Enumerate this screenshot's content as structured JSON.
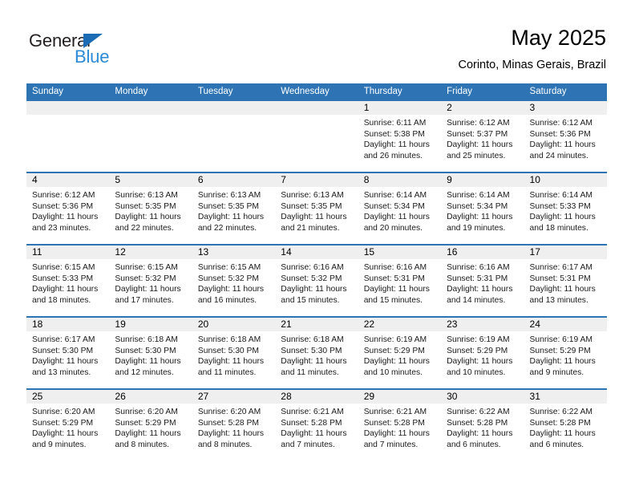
{
  "logo": {
    "word1": "General",
    "word2": "Blue",
    "triangle_color": "#1c6cb5",
    "word2_color": "#2c8ad6"
  },
  "header": {
    "title": "May 2025",
    "subtitle": "Corinto, Minas Gerais, Brazil"
  },
  "theme": {
    "header_bg": "#2e74b5",
    "header_text": "#ffffff",
    "daynum_band_bg": "#efefef",
    "cell_bg": "#ffffff",
    "week_divider": "#2e74b5"
  },
  "calendar": {
    "weekday_headers": [
      "Sunday",
      "Monday",
      "Tuesday",
      "Wednesday",
      "Thursday",
      "Friday",
      "Saturday"
    ],
    "weeks": [
      [
        {
          "day": "",
          "sunrise": "",
          "sunset": "",
          "daylight1": "",
          "daylight2": ""
        },
        {
          "day": "",
          "sunrise": "",
          "sunset": "",
          "daylight1": "",
          "daylight2": ""
        },
        {
          "day": "",
          "sunrise": "",
          "sunset": "",
          "daylight1": "",
          "daylight2": ""
        },
        {
          "day": "",
          "sunrise": "",
          "sunset": "",
          "daylight1": "",
          "daylight2": ""
        },
        {
          "day": "1",
          "sunrise": "Sunrise: 6:11 AM",
          "sunset": "Sunset: 5:38 PM",
          "daylight1": "Daylight: 11 hours",
          "daylight2": "and 26 minutes."
        },
        {
          "day": "2",
          "sunrise": "Sunrise: 6:12 AM",
          "sunset": "Sunset: 5:37 PM",
          "daylight1": "Daylight: 11 hours",
          "daylight2": "and 25 minutes."
        },
        {
          "day": "3",
          "sunrise": "Sunrise: 6:12 AM",
          "sunset": "Sunset: 5:36 PM",
          "daylight1": "Daylight: 11 hours",
          "daylight2": "and 24 minutes."
        }
      ],
      [
        {
          "day": "4",
          "sunrise": "Sunrise: 6:12 AM",
          "sunset": "Sunset: 5:36 PM",
          "daylight1": "Daylight: 11 hours",
          "daylight2": "and 23 minutes."
        },
        {
          "day": "5",
          "sunrise": "Sunrise: 6:13 AM",
          "sunset": "Sunset: 5:35 PM",
          "daylight1": "Daylight: 11 hours",
          "daylight2": "and 22 minutes."
        },
        {
          "day": "6",
          "sunrise": "Sunrise: 6:13 AM",
          "sunset": "Sunset: 5:35 PM",
          "daylight1": "Daylight: 11 hours",
          "daylight2": "and 22 minutes."
        },
        {
          "day": "7",
          "sunrise": "Sunrise: 6:13 AM",
          "sunset": "Sunset: 5:35 PM",
          "daylight1": "Daylight: 11 hours",
          "daylight2": "and 21 minutes."
        },
        {
          "day": "8",
          "sunrise": "Sunrise: 6:14 AM",
          "sunset": "Sunset: 5:34 PM",
          "daylight1": "Daylight: 11 hours",
          "daylight2": "and 20 minutes."
        },
        {
          "day": "9",
          "sunrise": "Sunrise: 6:14 AM",
          "sunset": "Sunset: 5:34 PM",
          "daylight1": "Daylight: 11 hours",
          "daylight2": "and 19 minutes."
        },
        {
          "day": "10",
          "sunrise": "Sunrise: 6:14 AM",
          "sunset": "Sunset: 5:33 PM",
          "daylight1": "Daylight: 11 hours",
          "daylight2": "and 18 minutes."
        }
      ],
      [
        {
          "day": "11",
          "sunrise": "Sunrise: 6:15 AM",
          "sunset": "Sunset: 5:33 PM",
          "daylight1": "Daylight: 11 hours",
          "daylight2": "and 18 minutes."
        },
        {
          "day": "12",
          "sunrise": "Sunrise: 6:15 AM",
          "sunset": "Sunset: 5:32 PM",
          "daylight1": "Daylight: 11 hours",
          "daylight2": "and 17 minutes."
        },
        {
          "day": "13",
          "sunrise": "Sunrise: 6:15 AM",
          "sunset": "Sunset: 5:32 PM",
          "daylight1": "Daylight: 11 hours",
          "daylight2": "and 16 minutes."
        },
        {
          "day": "14",
          "sunrise": "Sunrise: 6:16 AM",
          "sunset": "Sunset: 5:32 PM",
          "daylight1": "Daylight: 11 hours",
          "daylight2": "and 15 minutes."
        },
        {
          "day": "15",
          "sunrise": "Sunrise: 6:16 AM",
          "sunset": "Sunset: 5:31 PM",
          "daylight1": "Daylight: 11 hours",
          "daylight2": "and 15 minutes."
        },
        {
          "day": "16",
          "sunrise": "Sunrise: 6:16 AM",
          "sunset": "Sunset: 5:31 PM",
          "daylight1": "Daylight: 11 hours",
          "daylight2": "and 14 minutes."
        },
        {
          "day": "17",
          "sunrise": "Sunrise: 6:17 AM",
          "sunset": "Sunset: 5:31 PM",
          "daylight1": "Daylight: 11 hours",
          "daylight2": "and 13 minutes."
        }
      ],
      [
        {
          "day": "18",
          "sunrise": "Sunrise: 6:17 AM",
          "sunset": "Sunset: 5:30 PM",
          "daylight1": "Daylight: 11 hours",
          "daylight2": "and 13 minutes."
        },
        {
          "day": "19",
          "sunrise": "Sunrise: 6:18 AM",
          "sunset": "Sunset: 5:30 PM",
          "daylight1": "Daylight: 11 hours",
          "daylight2": "and 12 minutes."
        },
        {
          "day": "20",
          "sunrise": "Sunrise: 6:18 AM",
          "sunset": "Sunset: 5:30 PM",
          "daylight1": "Daylight: 11 hours",
          "daylight2": "and 11 minutes."
        },
        {
          "day": "21",
          "sunrise": "Sunrise: 6:18 AM",
          "sunset": "Sunset: 5:30 PM",
          "daylight1": "Daylight: 11 hours",
          "daylight2": "and 11 minutes."
        },
        {
          "day": "22",
          "sunrise": "Sunrise: 6:19 AM",
          "sunset": "Sunset: 5:29 PM",
          "daylight1": "Daylight: 11 hours",
          "daylight2": "and 10 minutes."
        },
        {
          "day": "23",
          "sunrise": "Sunrise: 6:19 AM",
          "sunset": "Sunset: 5:29 PM",
          "daylight1": "Daylight: 11 hours",
          "daylight2": "and 10 minutes."
        },
        {
          "day": "24",
          "sunrise": "Sunrise: 6:19 AM",
          "sunset": "Sunset: 5:29 PM",
          "daylight1": "Daylight: 11 hours",
          "daylight2": "and 9 minutes."
        }
      ],
      [
        {
          "day": "25",
          "sunrise": "Sunrise: 6:20 AM",
          "sunset": "Sunset: 5:29 PM",
          "daylight1": "Daylight: 11 hours",
          "daylight2": "and 9 minutes."
        },
        {
          "day": "26",
          "sunrise": "Sunrise: 6:20 AM",
          "sunset": "Sunset: 5:29 PM",
          "daylight1": "Daylight: 11 hours",
          "daylight2": "and 8 minutes."
        },
        {
          "day": "27",
          "sunrise": "Sunrise: 6:20 AM",
          "sunset": "Sunset: 5:28 PM",
          "daylight1": "Daylight: 11 hours",
          "daylight2": "and 8 minutes."
        },
        {
          "day": "28",
          "sunrise": "Sunrise: 6:21 AM",
          "sunset": "Sunset: 5:28 PM",
          "daylight1": "Daylight: 11 hours",
          "daylight2": "and 7 minutes."
        },
        {
          "day": "29",
          "sunrise": "Sunrise: 6:21 AM",
          "sunset": "Sunset: 5:28 PM",
          "daylight1": "Daylight: 11 hours",
          "daylight2": "and 7 minutes."
        },
        {
          "day": "30",
          "sunrise": "Sunrise: 6:22 AM",
          "sunset": "Sunset: 5:28 PM",
          "daylight1": "Daylight: 11 hours",
          "daylight2": "and 6 minutes."
        },
        {
          "day": "31",
          "sunrise": "Sunrise: 6:22 AM",
          "sunset": "Sunset: 5:28 PM",
          "daylight1": "Daylight: 11 hours",
          "daylight2": "and 6 minutes."
        }
      ]
    ]
  }
}
